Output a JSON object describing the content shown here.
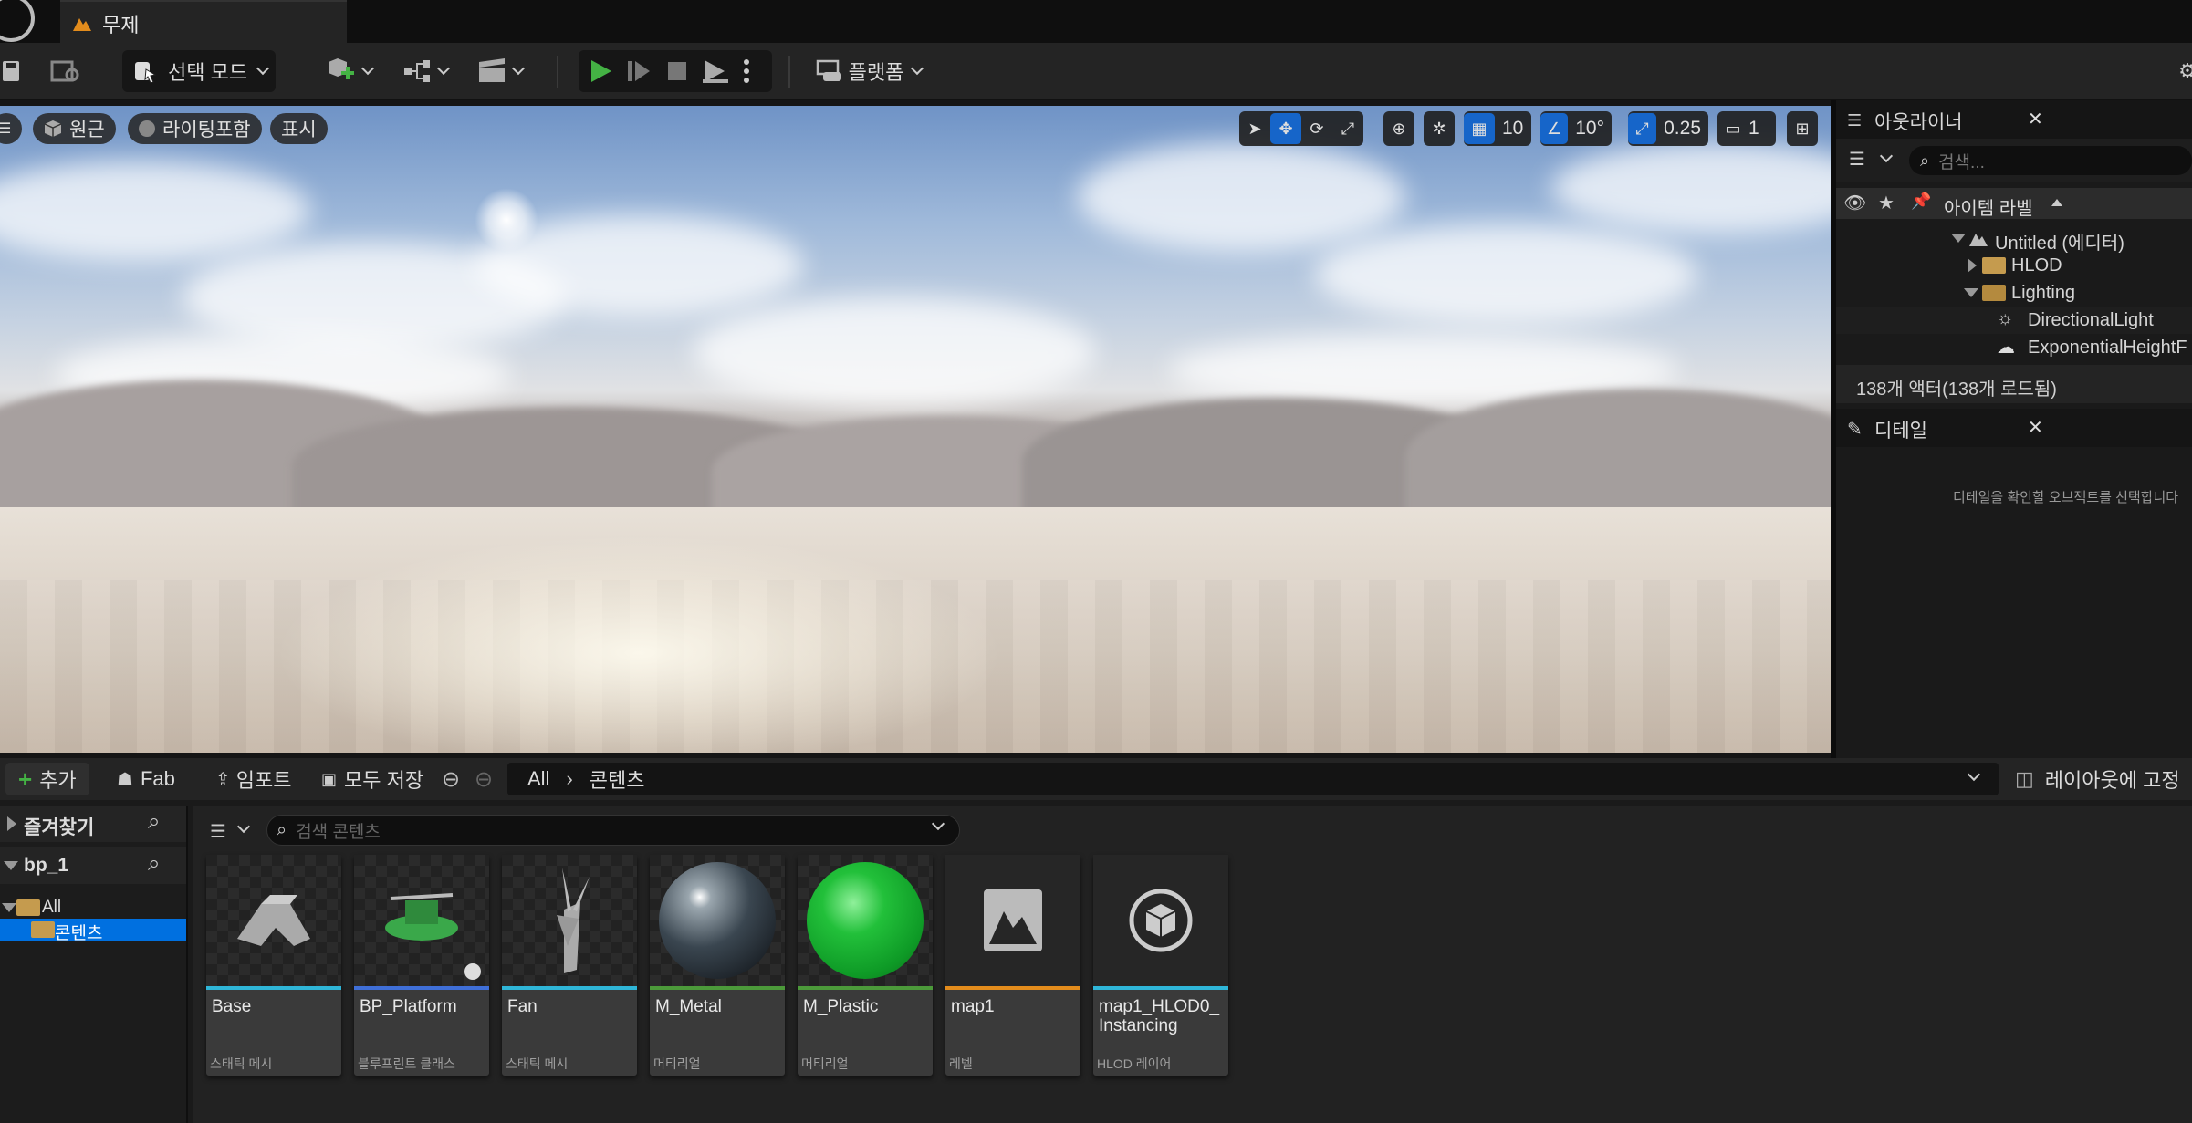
{
  "window": {
    "tab_title": "무제"
  },
  "toolbar": {
    "mode_label": "선택 모드",
    "platform_label": "플랫폼"
  },
  "viewport": {
    "perspective_label": "원근",
    "lighting_label": "라이팅포함",
    "show_label": "표시",
    "grid_snap_value": "10",
    "angle_snap_value": "10°",
    "scale_snap_value": "0.25",
    "camera_speed_value": "1"
  },
  "outliner": {
    "title": "아웃라이너",
    "search_placeholder": "검색...",
    "column_label": "아이템 라벨",
    "items": [
      {
        "label": "Untitled (에디터)"
      },
      {
        "label": "HLOD"
      },
      {
        "label": "Lighting"
      },
      {
        "label": "DirectionalLight"
      },
      {
        "label": "ExponentialHeightF"
      }
    ],
    "status": "138개 액터(138개 로드됨)"
  },
  "details": {
    "title": "디테일",
    "empty_message": "디테일을 확인할 오브젝트를 선택합니다"
  },
  "content_browser": {
    "add_label": "추가",
    "fab_label": "Fab",
    "import_label": "임포트",
    "save_all_label": "모두 저장",
    "breadcrumb": [
      "All",
      "콘텐츠"
    ],
    "dock_label": "레이아웃에 고정",
    "favorites_label": "즐겨찾기",
    "project_label": "bp_1",
    "tree": [
      "All",
      "콘텐츠"
    ],
    "search_placeholder": "검색 콘텐츠",
    "assets": [
      {
        "name": "Base",
        "type": "스태틱 메시",
        "color": "#2fb6d8"
      },
      {
        "name": "BP_Platform",
        "type": "블루프린트 클래스",
        "color": "#3f6fd8"
      },
      {
        "name": "Fan",
        "type": "스태틱 메시",
        "color": "#2fb6d8"
      },
      {
        "name": "M_Metal",
        "type": "머티리얼",
        "color": "#4c9a3a"
      },
      {
        "name": "M_Plastic",
        "type": "머티리얼",
        "color": "#4c9a3a"
      },
      {
        "name": "map1",
        "type": "레벨",
        "color": "#e38c1c"
      },
      {
        "name": "map1_HLOD0_\nInstancing",
        "type": "HLOD 레이어",
        "color": "#2fb6d8"
      }
    ]
  },
  "colors": {
    "accent": "#1665c9",
    "play_green": "#44b244",
    "selection": "#0070e0"
  }
}
